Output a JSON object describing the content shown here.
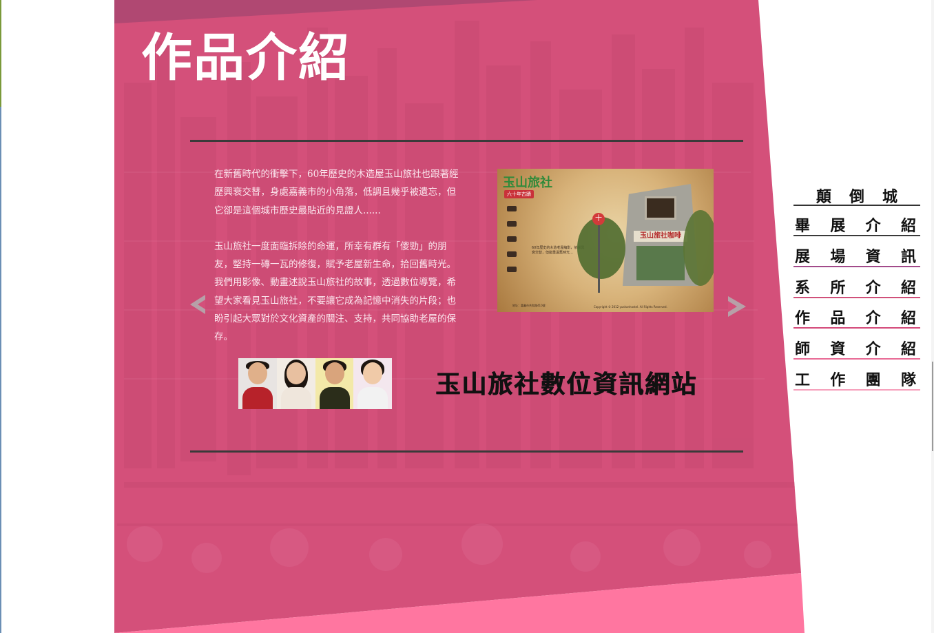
{
  "section_title": "作品介紹",
  "description": {
    "para1": "在新舊時代的衝擊下，60年歷史的木造屋玉山旅社也跟著經歷興衰交替，身處嘉義市的小角落，低調且幾乎被遺忘，但它卻是這個城市歷史最貼近的見證人......",
    "para2": "玉山旅社一度面臨拆除的命運，所幸有群有「傻勁」的朋友，堅持一磚一瓦的修復，賦予老屋新生命，拾回舊時光。我們用影像、動畫述說玉山旅社的故事，透過數位導覽，希望大家看見玉山旅社，不要讓它成為記憶中消失的片段；也盼引起大眾對於文化資產的關注、支持，共同協助老屋的保存。"
  },
  "carousel": {
    "prev_icon": "chevron-left-icon",
    "next_icon": "chevron-right-icon",
    "arrow_color": "#b7a0a8"
  },
  "screenshot": {
    "brand": "玉山旅社",
    "brand_sub": "六十年古蹟",
    "sign": "玉山旅社咖啡",
    "pole_sign": "十",
    "caption": "60年歷史的木造老屋縮影，依據興衰交替，但能重溫舊時光…",
    "footer": "地址：嘉義市共和路410號",
    "footer2": "Copyright © 2012 yushanhostel. All Rights Reserved."
  },
  "site_title": "玉山旅社數位資訊網站",
  "nav": {
    "items": [
      {
        "label": "顛倒城",
        "name": "nav-brand",
        "line": "#333333"
      },
      {
        "label": "畢展介紹",
        "name": "nav-exhibition-intro",
        "line": "#3a3a3a"
      },
      {
        "label": "展場資訊",
        "name": "nav-venue-info",
        "line": "#a24a8a"
      },
      {
        "label": "系所介紹",
        "name": "nav-department-intro",
        "line": "#d0507a"
      },
      {
        "label": "作品介紹",
        "name": "nav-works-intro",
        "line": "#d44a7a"
      },
      {
        "label": "師資介紹",
        "name": "nav-faculty-intro",
        "line": "#e86a95"
      },
      {
        "label": "工作團隊",
        "name": "nav-team",
        "line": "#f6a0bc"
      }
    ]
  },
  "colors": {
    "pink_main": "#d4507a",
    "pink_light": "#ff76a0",
    "title_white": "#ffffff",
    "rule": "#3a3a3a"
  }
}
